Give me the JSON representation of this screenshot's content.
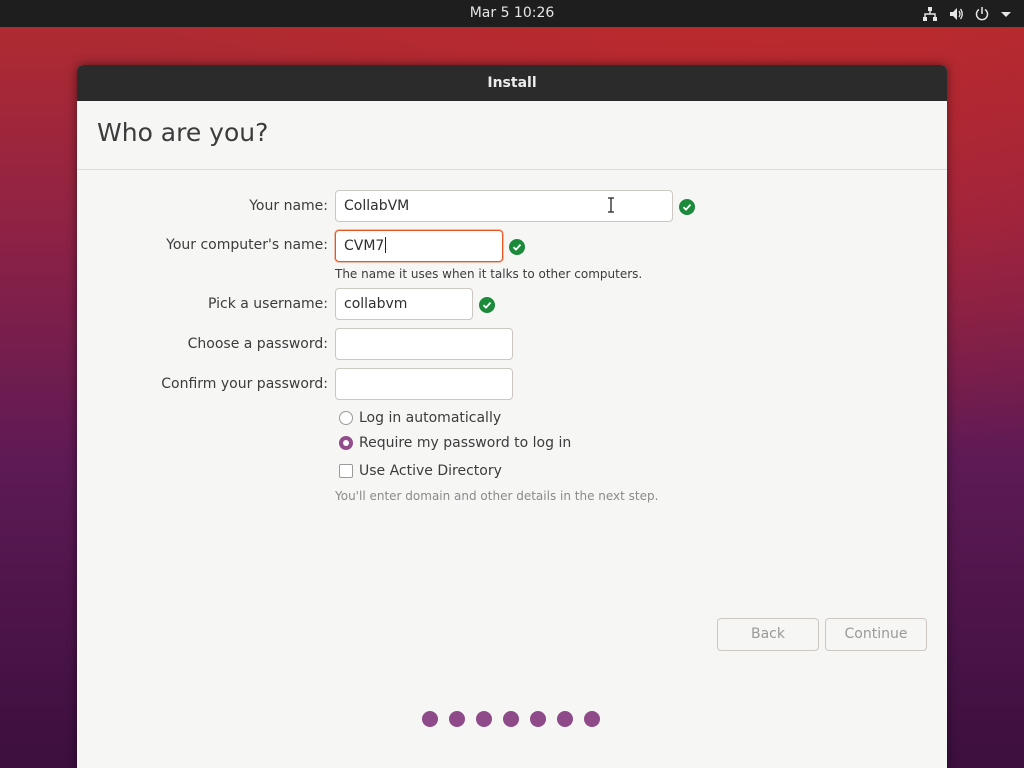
{
  "topbar": {
    "clock": "Mar 5  10:26",
    "icons": [
      "network-icon",
      "volume-icon",
      "power-icon",
      "menu-arrow-icon"
    ]
  },
  "window": {
    "title": "Install"
  },
  "page": {
    "heading": "Who are you?"
  },
  "form": {
    "name_label": "Your name:",
    "name_value": "CollabVM",
    "computer_label": "Your computer's name:",
    "computer_value": "CVM7",
    "computer_hint": "The name it uses when it talks to other computers.",
    "username_label": "Pick a username:",
    "username_value": "collabvm",
    "password_label": "Choose a password:",
    "password_value": "",
    "confirm_label": "Confirm your password:",
    "confirm_value": "",
    "login_auto": "Log in automatically",
    "login_password": "Require my password to log in",
    "login_selected": "Require my password to log in",
    "active_directory": "Use Active Directory",
    "active_directory_checked": false,
    "ad_hint": "You'll enter domain and other details in the next step."
  },
  "buttons": {
    "back": "Back",
    "continue": "Continue"
  },
  "progress": {
    "step_count": 7
  },
  "colors": {
    "accent": "#e95420",
    "aubergine": "#924d8b",
    "valid": "#1b8a3a"
  }
}
